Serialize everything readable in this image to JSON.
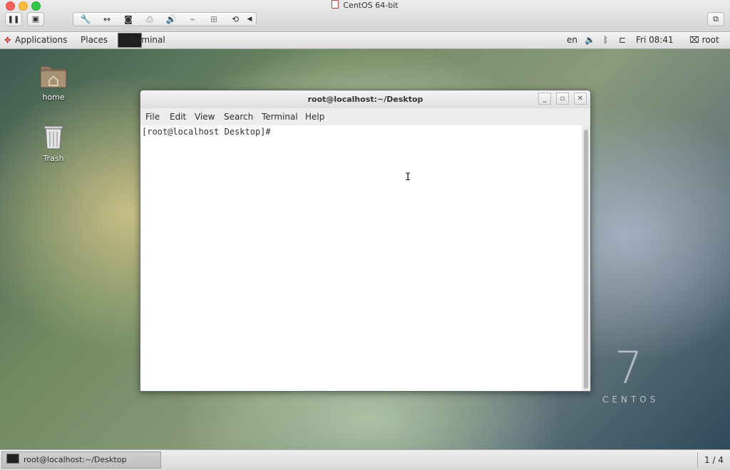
{
  "host": {
    "title": "CentOS 64-bit",
    "traffic_lights": {
      "close": "#fc605c",
      "minimize": "#fdbc40",
      "zoom": "#34c84a"
    },
    "toolbar_icons": [
      "pause-icon",
      "snapshot-icon",
      "settings-wrench-icon",
      "network-arrows-icon",
      "cd-disc-icon",
      "printer-icon",
      "sound-icon",
      "usb-icon",
      "camera-share-icon",
      "refresh-icon",
      "collapse-arrow-icon",
      "fullscreen-icon"
    ]
  },
  "panel": {
    "applications": "Applications",
    "places": "Places",
    "task": "Terminal",
    "lang": "en",
    "clock": "Fri 08:41",
    "user": "root"
  },
  "desktop": {
    "icons": [
      {
        "label": "home"
      },
      {
        "label": "Trash"
      }
    ],
    "logo_number": "7",
    "logo_word": "CENTOS"
  },
  "terminal": {
    "title": "root@localhost:~/Desktop",
    "menu": [
      "File",
      "Edit",
      "View",
      "Search",
      "Terminal",
      "Help"
    ],
    "prompt": "[root@localhost Desktop]#"
  },
  "bottom": {
    "task_label": "root@localhost:~/Desktop",
    "workspace": "1 / 4"
  }
}
